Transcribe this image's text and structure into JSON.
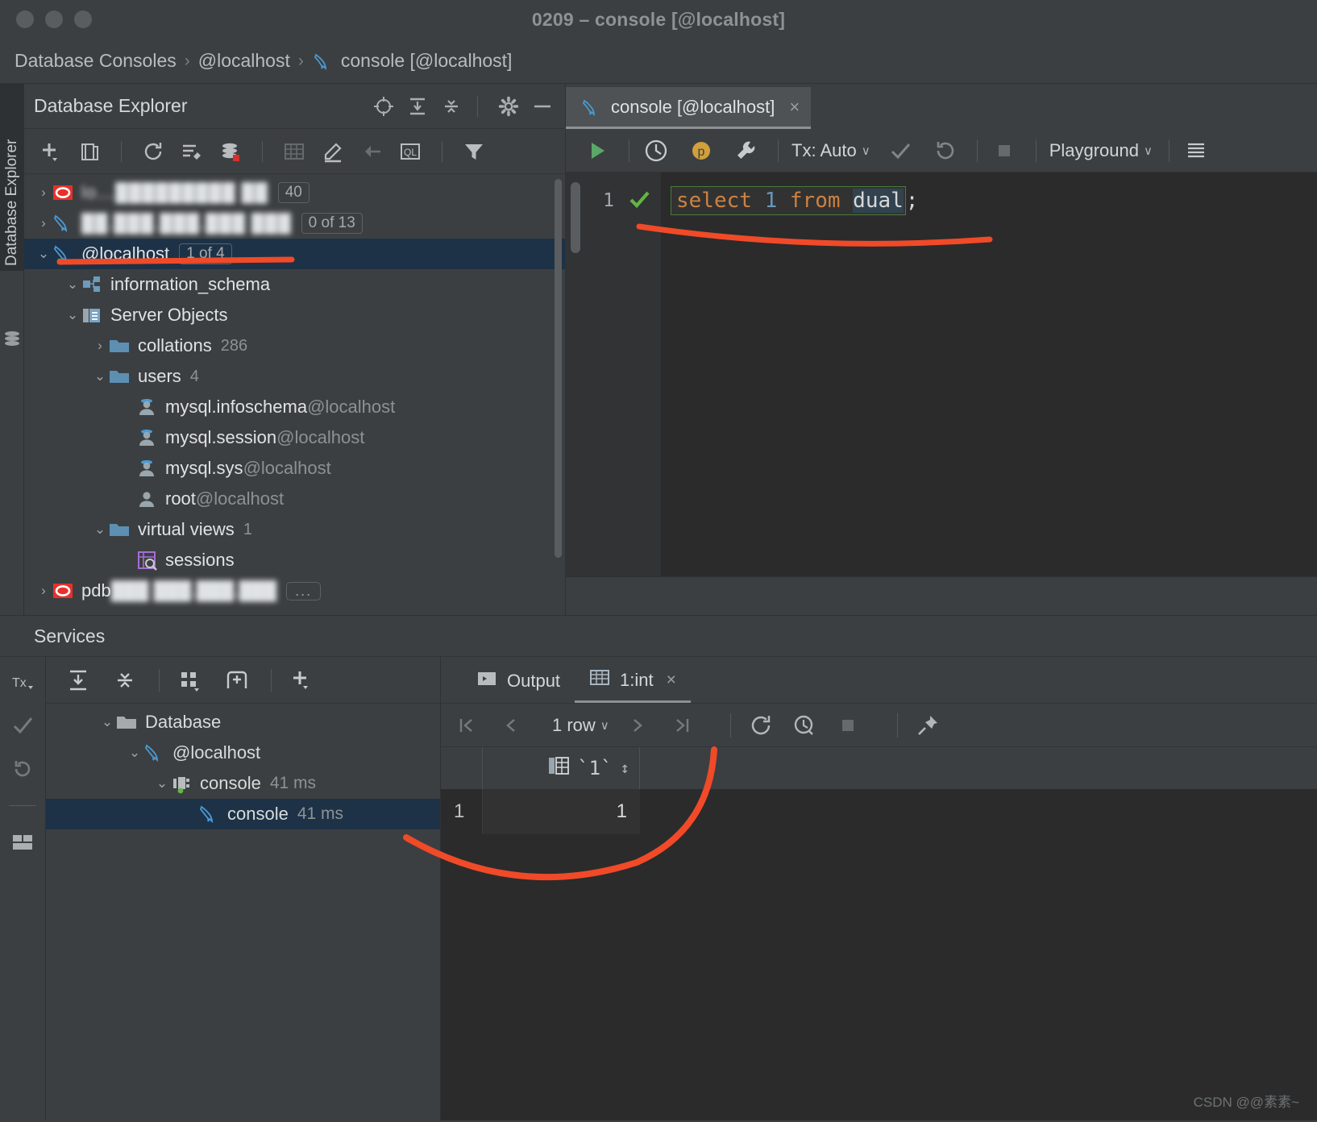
{
  "window": {
    "title": "0209 – console [@localhost]"
  },
  "breadcrumb": {
    "items": [
      "Database Consoles",
      "@localhost",
      "console [@localhost]"
    ],
    "separator": "›"
  },
  "left_strip": {
    "tool_window_label": "Database Explorer"
  },
  "db_explorer": {
    "title": "Database Explorer",
    "header_icons": [
      "locate-icon",
      "expand-all-icon",
      "collapse-all-icon",
      "gear-icon",
      "minimize-icon"
    ],
    "toolbar_icons": [
      "add-icon",
      "duplicate-icon",
      "refresh-icon",
      "modify-icon",
      "database-tools-icon",
      "table-icon",
      "edit-icon",
      "jump-to-source-icon",
      "ql-icon",
      "filter-icon"
    ],
    "tree": [
      {
        "indent": 0,
        "chevron": "›",
        "icon": "oracle-db-icon",
        "label": "",
        "blurred": true,
        "badge": "40"
      },
      {
        "indent": 0,
        "chevron": "›",
        "icon": "mysql-icon",
        "label": "",
        "blurred": true,
        "badge": "0 of 13"
      },
      {
        "indent": 0,
        "chevron": "⌄",
        "icon": "mysql-connected-icon",
        "label": "@localhost",
        "badge": "1 of 4",
        "selected": true
      },
      {
        "indent": 1,
        "chevron": "⌄",
        "icon": "schema-icon",
        "label": "information_schema"
      },
      {
        "indent": 1,
        "chevron": "⌄",
        "icon": "server-objects-icon",
        "label": "Server Objects"
      },
      {
        "indent": 2,
        "chevron": "›",
        "icon": "folder-icon",
        "label": "collations",
        "count": "286"
      },
      {
        "indent": 2,
        "chevron": "⌄",
        "icon": "folder-icon",
        "label": "users",
        "count": "4"
      },
      {
        "indent": 3,
        "chevron": "",
        "icon": "user-icon",
        "label": "mysql.infoschema",
        "suffix": "@localhost"
      },
      {
        "indent": 3,
        "chevron": "",
        "icon": "user-icon",
        "label": "mysql.session",
        "suffix": "@localhost"
      },
      {
        "indent": 3,
        "chevron": "",
        "icon": "user-icon",
        "label": "mysql.sys",
        "suffix": "@localhost"
      },
      {
        "indent": 3,
        "chevron": "",
        "icon": "user-plain-icon",
        "label": "root",
        "suffix": "@localhost"
      },
      {
        "indent": 2,
        "chevron": "⌄",
        "icon": "folder-icon",
        "label": "virtual views",
        "count": "1"
      },
      {
        "indent": 3,
        "chevron": "",
        "icon": "virtual-view-icon",
        "label": "sessions"
      },
      {
        "indent": 0,
        "chevron": "›",
        "icon": "oracle-db-icon",
        "label": "pdb",
        "blurred_tail": true,
        "dots": "..."
      }
    ]
  },
  "editor": {
    "tab": {
      "label": "console [@localhost]",
      "close": "×",
      "icon": "mysql-icon"
    },
    "toolbar": {
      "run_icon": "run-icon",
      "history_icon": "history-icon",
      "param_icon": "parameters-icon",
      "wrench_icon": "wrench-icon",
      "tx_label": "Tx: Auto",
      "commit_icon": "commit-icon",
      "rollback_icon": "rollback-icon",
      "stop_icon": "stop-icon",
      "schema_label": "Playground",
      "grid_icon": "data-source-icon",
      "caret": "∨"
    },
    "line_number": "1",
    "status_icon": "check-ok-icon",
    "code": {
      "tokens": [
        {
          "text": "select",
          "kind": "keyword"
        },
        {
          "text": " ",
          "kind": "plain"
        },
        {
          "text": "1",
          "kind": "number"
        },
        {
          "text": " ",
          "kind": "plain"
        },
        {
          "text": "from",
          "kind": "keyword"
        },
        {
          "text": " ",
          "kind": "plain"
        },
        {
          "text": "dual",
          "kind": "identifier"
        }
      ],
      "terminator": ";"
    }
  },
  "services": {
    "title": "Services",
    "side_icons": [
      "tx-icon",
      "commit-icon",
      "rollback-icon",
      "layout-icon"
    ],
    "toolbar_icons": [
      "expand-all-icon",
      "collapse-all-icon",
      "group-icon",
      "add-tab-icon",
      "add-icon"
    ],
    "tree": [
      {
        "indent": 0,
        "chevron": "⌄",
        "icon": "folder-icon",
        "label": "Database"
      },
      {
        "indent": 1,
        "chevron": "⌄",
        "icon": "mysql-icon",
        "label": "@localhost"
      },
      {
        "indent": 2,
        "chevron": "⌄",
        "icon": "console-running-icon",
        "label": "console",
        "time": "41 ms"
      },
      {
        "indent": 3,
        "chevron": "",
        "icon": "mysql-icon",
        "label": "console",
        "time": "41 ms",
        "selected": true
      }
    ],
    "output": {
      "tabs": [
        {
          "label": "Output",
          "icon": "output-icon",
          "active": false,
          "closable": false
        },
        {
          "label": "1:int",
          "icon": "table-icon",
          "active": true,
          "closable": true,
          "close": "×"
        }
      ],
      "grid_toolbar": {
        "first_icon": "first-page-icon",
        "prev_icon": "prev-page-icon",
        "row_count_label": "1 row",
        "caret": "∨",
        "next_icon": "next-page-icon",
        "last_icon": "last-page-icon",
        "reload_icon": "reload-icon",
        "history_icon": "query-history-icon",
        "stop_icon": "stop-icon",
        "pin_icon": "pin-icon"
      },
      "grid": {
        "columns": [
          {
            "name": "`1`",
            "icon": "column-int-icon",
            "sort": "↕"
          }
        ],
        "rows": [
          {
            "num": "1",
            "cells": [
              "1"
            ]
          }
        ]
      }
    }
  },
  "watermark": {
    "text": "CSDN @@素素~"
  },
  "colors": {
    "selection_blue": "#1d3247",
    "annotation_red": "#f04a28",
    "keyword_orange": "#cc8242",
    "number_blue": "#6897bb",
    "run_green": "#59a869",
    "mysql_blue": "#4a9bd5",
    "oracle_red": "#e8302a",
    "status_green": "#62b543"
  }
}
